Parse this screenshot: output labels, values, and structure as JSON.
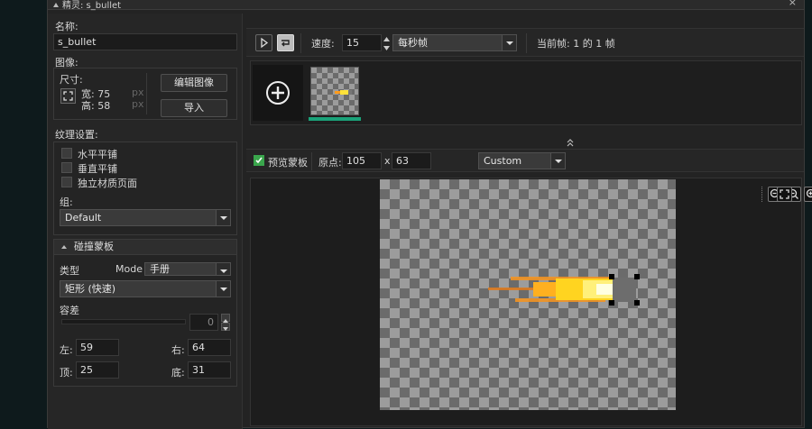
{
  "window": {
    "title": "精灵: s_bullet",
    "close": "×"
  },
  "left": {
    "name_label": "名称:",
    "name_value": "s_bullet",
    "image_label": "图像:",
    "size_label": "尺寸:",
    "width_label": "宽: 75",
    "height_label": "高: 58",
    "unit_w": "px",
    "unit_h": "px",
    "edit_image": "编辑图像",
    "import": "导入",
    "texture_label": "纹理设置:",
    "htile": "水平平铺",
    "vtile": "垂直平铺",
    "separate_page": "独立材质页面",
    "group_label": "组:",
    "group_value": "Default",
    "collision_header": "碰撞蒙板",
    "type_label": "类型",
    "mode_label": "Mode",
    "mode_value": "手册",
    "shape_value": "矩形 (快速)",
    "tolerance_label": "容差",
    "tolerance_value": "0",
    "left_label": "左:",
    "left_value": "59",
    "right_label": "右:",
    "right_value": "64",
    "top_label": "顶:",
    "top_value": "25",
    "bottom_label": "底:",
    "bottom_value": "31"
  },
  "toolbar": {
    "speed_label": "速度:",
    "speed_value": "15",
    "speed_unit": "每秒帧",
    "current_frame": "当前帧: 1 的 1 帧"
  },
  "mask_bar": {
    "preview_mask": "预览蒙板",
    "origin_label": "原点:",
    "origin_x": "105",
    "x_sep": "x",
    "origin_y": "63",
    "origin_preset": "Custom"
  },
  "colors": {
    "accent": "#1aa37a",
    "checkbox_green": "#3aa64c"
  }
}
